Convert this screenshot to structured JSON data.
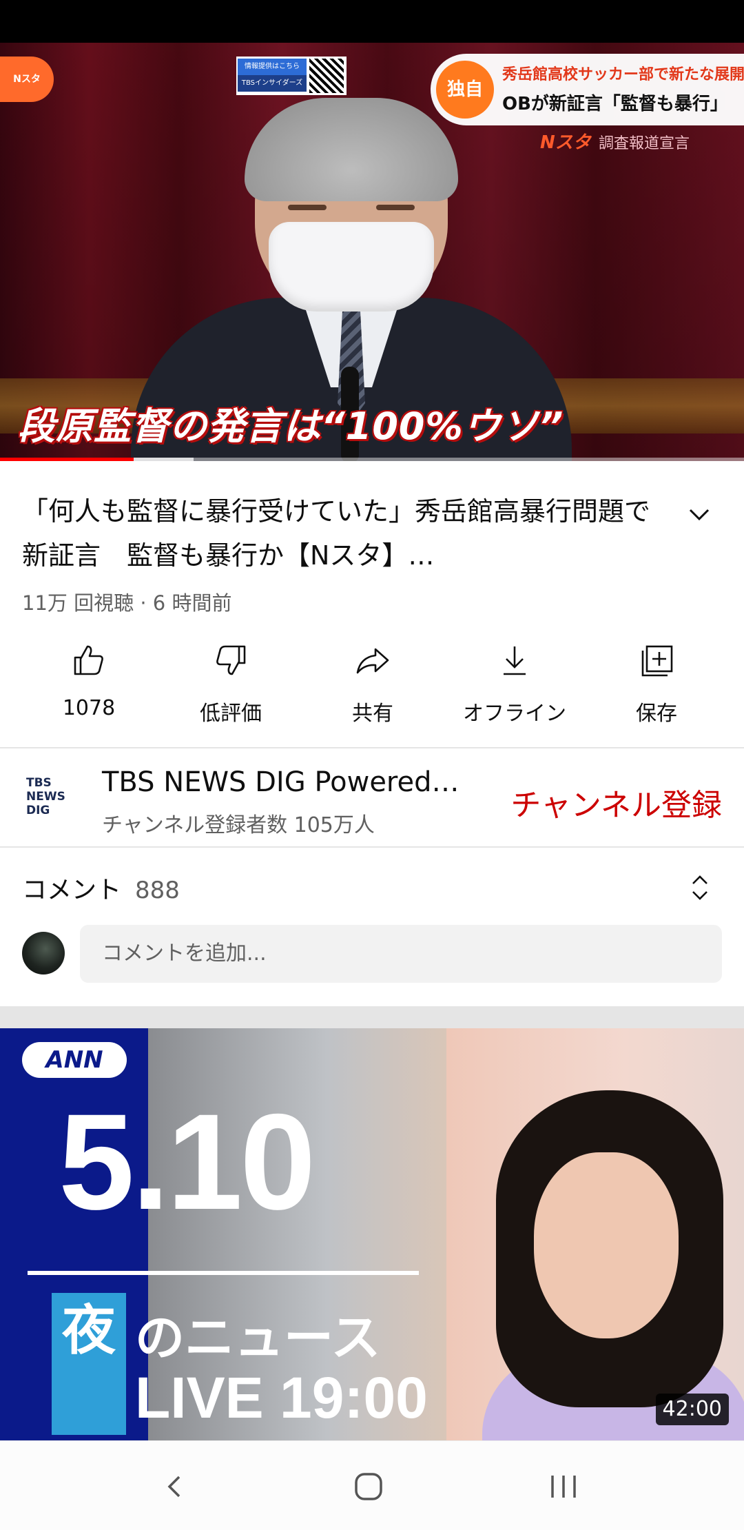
{
  "video": {
    "overlay": {
      "logo": "Nスタ",
      "qr_label_top": "情報提供はこちら",
      "qr_label_bottom": "TBSインサイダーズ",
      "exclusive_badge": "独自",
      "headline_line1": "秀岳館高校サッカー部で新たな展開",
      "headline_line2": "OBが新証言「監督も暴行」",
      "program_logo": "Nスタ",
      "program_caption": "調査報道宣言",
      "caption": "段原監督の発言は“100%ウソ”"
    },
    "progress": {
      "played_fraction": 0.18,
      "buffered_fraction": 0.26
    }
  },
  "title": "「何人も監督に暴行受けていた」秀岳館高暴行問題で新証言　監督も暴行か【Nスタ】…",
  "meta": "11万 回視聴 · 6 時間前",
  "actions": [
    {
      "label": "1078",
      "icon": "thumbs-up-icon"
    },
    {
      "label": "低評価",
      "icon": "thumbs-down-icon"
    },
    {
      "label": "共有",
      "icon": "share-icon"
    },
    {
      "label": "オフライン",
      "icon": "download-icon"
    },
    {
      "label": "保存",
      "icon": "save-playlist-icon"
    }
  ],
  "channel": {
    "logo_text": "TBS NEWS DIG",
    "name": "TBS NEWS DIG Powered…",
    "subscribers": "チャンネル登録者数 105万人",
    "subscribe_label": "チャンネル登録"
  },
  "comments": {
    "label": "コメント",
    "count": "888",
    "placeholder": "コメントを追加..."
  },
  "next_video": {
    "network": "ANN",
    "date": "5.10",
    "yoru": "夜",
    "news": "のニュース",
    "live": "LIVE 19:00",
    "duration": "42:00"
  },
  "colors": {
    "accent_red": "#cc0000",
    "progress_red": "#ff0000",
    "text_secondary": "#606060"
  }
}
